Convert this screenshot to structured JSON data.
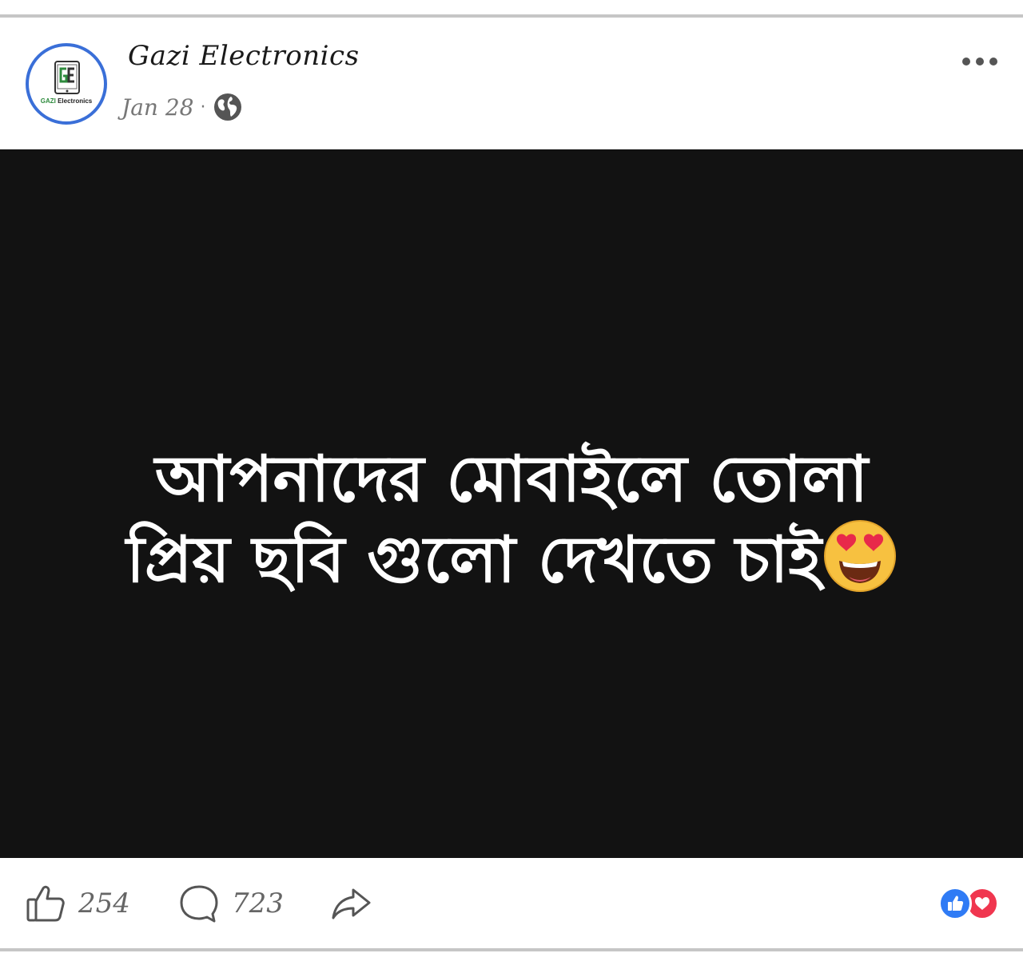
{
  "post": {
    "page_name": "Gazi Electronics",
    "date": "Jan 28",
    "separator": "·",
    "audience_icon": "globe-icon",
    "menu_icon": "more-options-icon"
  },
  "avatar": {
    "logo_letters": "GE",
    "logo_caption_brand": "GAZI",
    "logo_caption_rest": " Electronics",
    "ring_color": "#3a6fd8",
    "accent_color": "#2e8b3d"
  },
  "media": {
    "background_color": "#121212",
    "text_color": "#ffffff",
    "caption_line1": "আপনাদের মোবাইলে তোলা",
    "caption_line2": "প্রিয় ছবি গুলো দেখতে চাই",
    "emoji": "smiling-face-with-heart-eyes-icon"
  },
  "actions": {
    "like_count": "254",
    "comment_count": "723",
    "like_icon": "thumbs-up-icon",
    "comment_icon": "comment-bubble-icon",
    "share_icon": "share-arrow-icon"
  },
  "reactions": [
    {
      "icon": "like-reaction-icon",
      "color": "#2f7bf5"
    },
    {
      "icon": "love-reaction-icon",
      "color": "#f0364f"
    }
  ]
}
